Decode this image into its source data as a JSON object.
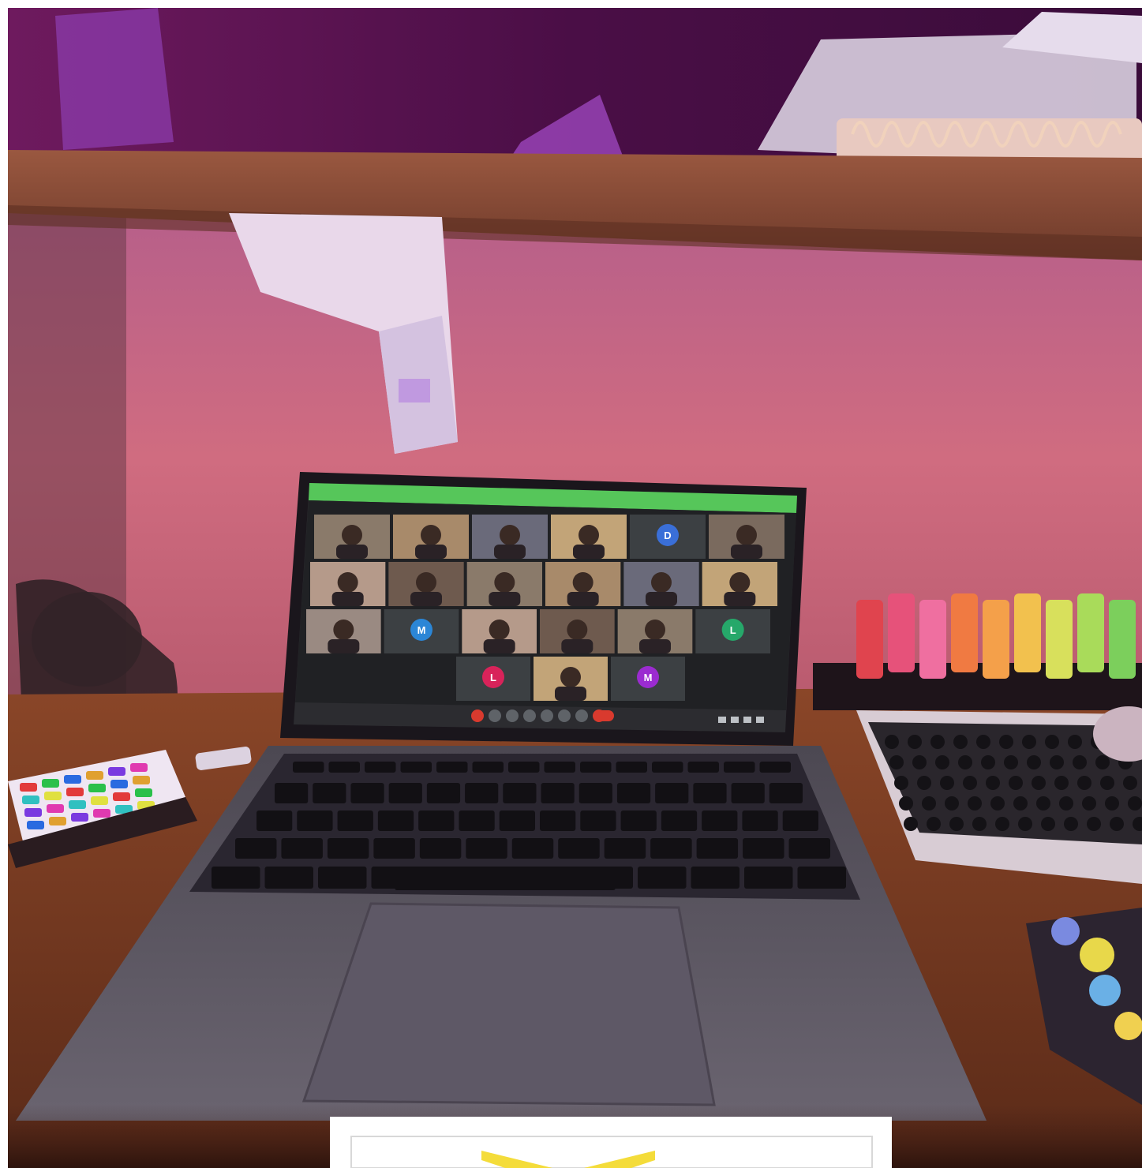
{
  "photo": {
    "subject": "laptop-on-desk-showing-video-call"
  },
  "video_call": {
    "app_bar_color": "#56c65a",
    "grid_rows": [
      [
        {
          "kind": "video"
        },
        {
          "kind": "video"
        },
        {
          "kind": "video"
        },
        {
          "kind": "video"
        },
        {
          "kind": "avatar",
          "initial": "D",
          "color": "#3a6fd8"
        },
        {
          "kind": "video"
        }
      ],
      [
        {
          "kind": "video"
        },
        {
          "kind": "video"
        },
        {
          "kind": "video"
        },
        {
          "kind": "video"
        },
        {
          "kind": "video"
        },
        {
          "kind": "video"
        }
      ],
      [
        {
          "kind": "video"
        },
        {
          "kind": "avatar",
          "initial": "M",
          "color": "#2b86d6"
        },
        {
          "kind": "video"
        },
        {
          "kind": "video"
        },
        {
          "kind": "video"
        },
        {
          "kind": "avatar",
          "initial": "L",
          "color": "#26a86a"
        }
      ],
      [
        {
          "kind": "avatar",
          "initial": "L",
          "color": "#d8235a"
        },
        {
          "kind": "video"
        },
        {
          "kind": "avatar",
          "initial": "M",
          "color": "#9b2bd0"
        }
      ]
    ],
    "control_bar": {
      "end_call_color": "#d93a2e",
      "button_count": 8
    }
  },
  "colors": {
    "wall": "#c86a86",
    "shelf": "#8a4a36",
    "desk": "#7a3e22",
    "laptop": "#5a5560",
    "keyboard": "#1c1a20",
    "marker_colors": [
      "#e0444e",
      "#e6527a",
      "#ef6fa0",
      "#f07a42",
      "#f4a04a",
      "#f2c14e",
      "#d8e05c",
      "#a9db5a",
      "#7ccf5c"
    ]
  }
}
